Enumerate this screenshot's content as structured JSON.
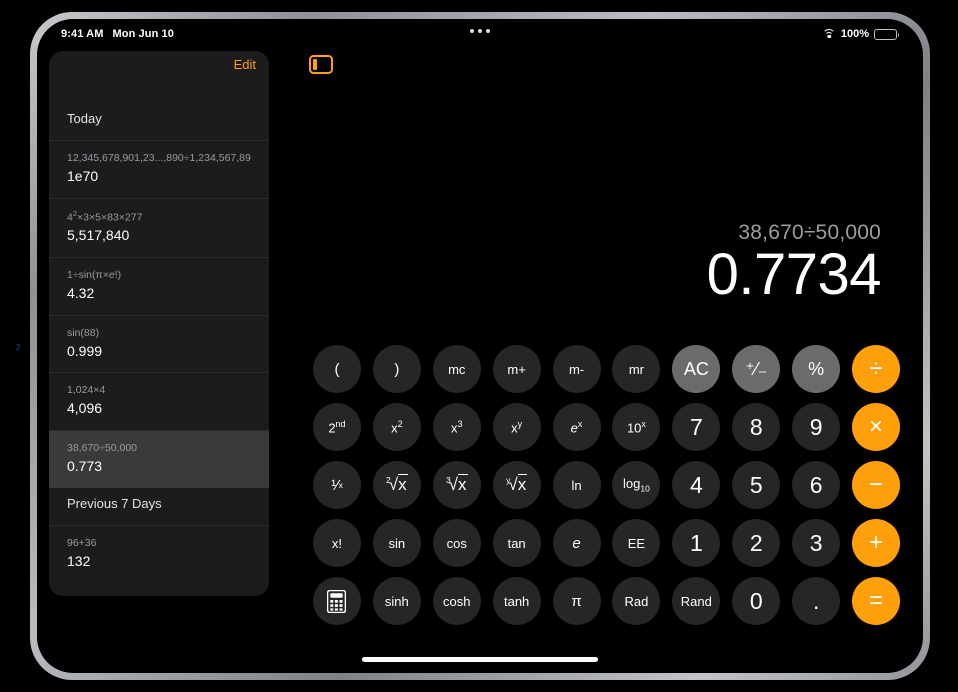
{
  "status_bar": {
    "time": "9:41 AM",
    "date": "Mon Jun 10",
    "battery_percent": "100%",
    "wifi_icon": "wifi-icon",
    "battery_icon": "battery-icon"
  },
  "multitask": {
    "icon": "more-dots-icon"
  },
  "sidebar": {
    "edit_label": "Edit",
    "toggle_icon": "sidebar-toggle-icon",
    "sections": [
      {
        "title": "Today",
        "items": [
          {
            "expression": "12,345,678,901,23...,890÷1,234,567,890",
            "result": "1e70",
            "selected": false
          },
          {
            "expression": "4²×3×5×83×277",
            "result": "5,517,840",
            "selected": false
          },
          {
            "expression": "1÷sin(π×e!)",
            "result": "4.32",
            "selected": false
          },
          {
            "expression": "sin(88)",
            "result": "0.999",
            "selected": false
          },
          {
            "expression": "1,024×4",
            "result": "4,096",
            "selected": false
          },
          {
            "expression": "38,670÷50,000",
            "result": "0.773",
            "selected": true
          }
        ]
      },
      {
        "title": "Previous 7 Days",
        "items": [
          {
            "expression": "96+36",
            "result": "132",
            "selected": false
          }
        ]
      }
    ]
  },
  "display": {
    "expression": "38,670÷50,000",
    "result": "0.7734"
  },
  "keypad": {
    "rows": [
      [
        {
          "label": "(",
          "name": "key-open-paren",
          "style": "fn"
        },
        {
          "label": ")",
          "name": "key-close-paren",
          "style": "fn"
        },
        {
          "label": "mc",
          "name": "key-mc",
          "style": "fn-small"
        },
        {
          "label": "m+",
          "name": "key-m-plus",
          "style": "fn-small"
        },
        {
          "label": "m-",
          "name": "key-m-minus",
          "style": "fn-small"
        },
        {
          "label": "mr",
          "name": "key-mr",
          "style": "fn-small"
        },
        {
          "label": "AC",
          "name": "key-all-clear",
          "style": "fn-light"
        },
        {
          "label": "⁺⁄₋",
          "name": "key-plus-minus",
          "style": "fn-light"
        },
        {
          "label": "%",
          "name": "key-percent",
          "style": "fn-light"
        },
        {
          "label": "÷",
          "name": "key-divide",
          "style": "op"
        }
      ],
      [
        {
          "label": "2nd",
          "name": "key-second",
          "style": "sup",
          "base": "2",
          "sup": "nd"
        },
        {
          "label": "x²",
          "name": "key-x-squared",
          "style": "sup",
          "base": "x",
          "sup": "2"
        },
        {
          "label": "x³",
          "name": "key-x-cubed",
          "style": "sup",
          "base": "x",
          "sup": "3"
        },
        {
          "label": "xʸ",
          "name": "key-x-to-y",
          "style": "sup",
          "base": "x",
          "sup": "y"
        },
        {
          "label": "eˣ",
          "name": "key-e-to-x",
          "style": "sup-italic",
          "base": "e",
          "sup": "x"
        },
        {
          "label": "10ˣ",
          "name": "key-ten-to-x",
          "style": "sup",
          "base": "10",
          "sup": "x"
        },
        {
          "label": "7",
          "name": "key-7",
          "style": "digit"
        },
        {
          "label": "8",
          "name": "key-8",
          "style": "digit"
        },
        {
          "label": "9",
          "name": "key-9",
          "style": "digit"
        },
        {
          "label": "×",
          "name": "key-multiply",
          "style": "op"
        }
      ],
      [
        {
          "label": "1/x",
          "name": "key-reciprocal",
          "style": "fraction"
        },
        {
          "label": "²√x",
          "name": "key-square-root",
          "style": "radical",
          "index": "2"
        },
        {
          "label": "³√x",
          "name": "key-cube-root",
          "style": "radical",
          "index": "3"
        },
        {
          "label": "ʸ√x",
          "name": "key-nth-root",
          "style": "radical",
          "index": "y"
        },
        {
          "label": "ln",
          "name": "key-natural-log",
          "style": "fn-small"
        },
        {
          "label": "log10",
          "name": "key-log-base-10",
          "style": "sub",
          "base": "log",
          "sub": "10"
        },
        {
          "label": "4",
          "name": "key-4",
          "style": "digit"
        },
        {
          "label": "5",
          "name": "key-5",
          "style": "digit"
        },
        {
          "label": "6",
          "name": "key-6",
          "style": "digit"
        },
        {
          "label": "−",
          "name": "key-subtract",
          "style": "op"
        }
      ],
      [
        {
          "label": "x!",
          "name": "key-factorial",
          "style": "fn-small"
        },
        {
          "label": "sin",
          "name": "key-sin",
          "style": "fn-small"
        },
        {
          "label": "cos",
          "name": "key-cos",
          "style": "fn-small"
        },
        {
          "label": "tan",
          "name": "key-tan",
          "style": "fn-small"
        },
        {
          "label": "e",
          "name": "key-euler",
          "style": "italic"
        },
        {
          "label": "EE",
          "name": "key-ee",
          "style": "fn-small"
        },
        {
          "label": "1",
          "name": "key-1",
          "style": "digit"
        },
        {
          "label": "2",
          "name": "key-2",
          "style": "digit"
        },
        {
          "label": "3",
          "name": "key-3",
          "style": "digit"
        },
        {
          "label": "+",
          "name": "key-add",
          "style": "op"
        }
      ],
      [
        {
          "label": "",
          "name": "key-calculator-mode",
          "style": "icon-calculator"
        },
        {
          "label": "sinh",
          "name": "key-sinh",
          "style": "fn-small"
        },
        {
          "label": "cosh",
          "name": "key-cosh",
          "style": "fn-small"
        },
        {
          "label": "tanh",
          "name": "key-tanh",
          "style": "fn-small"
        },
        {
          "label": "π",
          "name": "key-pi",
          "style": "fn"
        },
        {
          "label": "Rad",
          "name": "key-rad",
          "style": "fn-small"
        },
        {
          "label": "Rand",
          "name": "key-rand",
          "style": "fn-small"
        },
        {
          "label": "0",
          "name": "key-0",
          "style": "digit"
        },
        {
          "label": ".",
          "name": "key-decimal",
          "style": "digit"
        },
        {
          "label": "=",
          "name": "key-equals",
          "style": "op"
        }
      ]
    ]
  },
  "colors": {
    "accent_orange": "#ff9f0a",
    "key_dark": "#262628",
    "key_light": "#6b6b6e",
    "sidebar_bg": "#1c1c1e",
    "selected_row": "#3a3a3c"
  }
}
